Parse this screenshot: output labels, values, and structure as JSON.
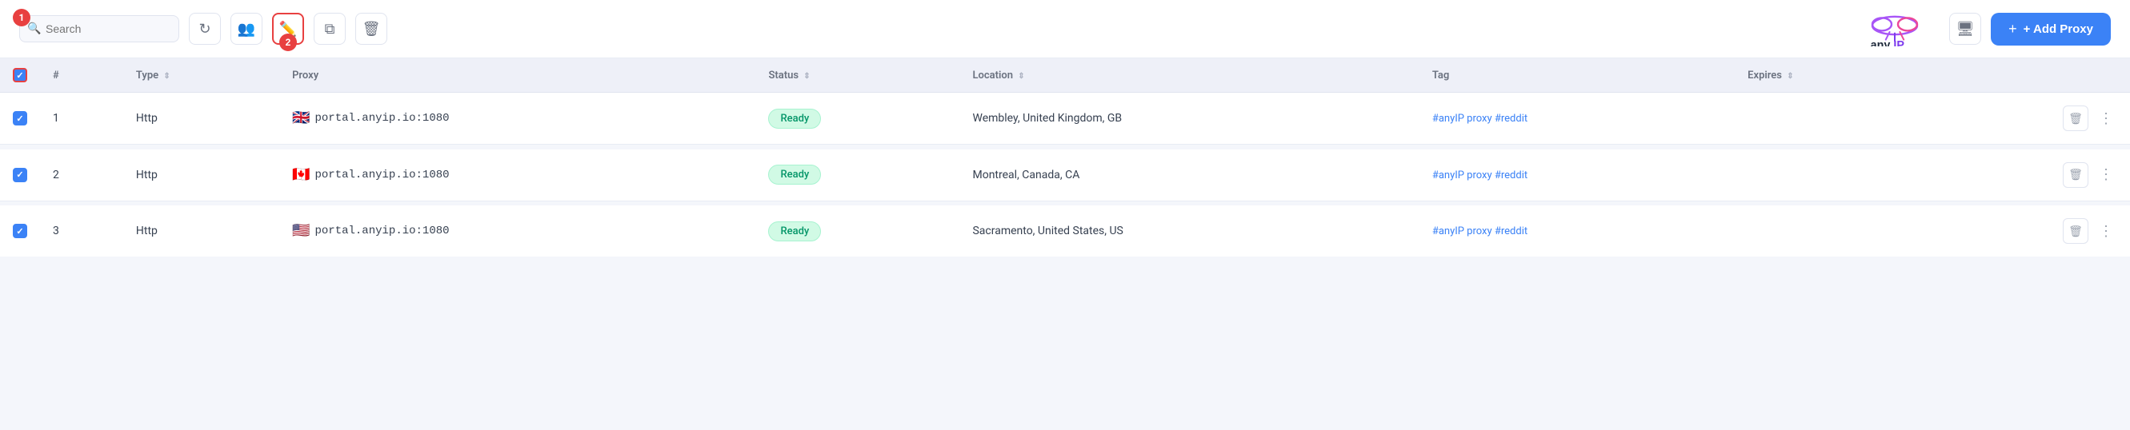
{
  "toolbar": {
    "search_placeholder": "Search",
    "refresh_label": "Refresh",
    "accounts_label": "Accounts",
    "edit_label": "Edit",
    "copy_label": "Copy",
    "delete_label": "Delete",
    "add_proxy_label": "+ Add Proxy",
    "monitor_label": "Monitor",
    "badge1": "1",
    "badge2": "2"
  },
  "table": {
    "columns": [
      {
        "key": "checkbox",
        "label": ""
      },
      {
        "key": "number",
        "label": "#"
      },
      {
        "key": "type",
        "label": "Type"
      },
      {
        "key": "proxy",
        "label": "Proxy"
      },
      {
        "key": "status",
        "label": "Status"
      },
      {
        "key": "location",
        "label": "Location"
      },
      {
        "key": "tag",
        "label": "Tag"
      },
      {
        "key": "expires",
        "label": "Expires"
      },
      {
        "key": "actions",
        "label": ""
      }
    ],
    "rows": [
      {
        "number": "1",
        "type": "Http",
        "flag": "🇬🇧",
        "proxy": "portal.anyip.io:1080",
        "status": "Ready",
        "location": "Wembley, United Kingdom, GB",
        "tags": "#anyIP proxy #reddit"
      },
      {
        "number": "2",
        "type": "Http",
        "flag": "🇨🇦",
        "proxy": "portal.anyip.io:1080",
        "status": "Ready",
        "location": "Montreal, Canada, CA",
        "tags": "#anyIP proxy #reddit"
      },
      {
        "number": "3",
        "type": "Http",
        "flag": "🇺🇸",
        "proxy": "portal.anyip.io:1080",
        "status": "Ready",
        "location": "Sacramento, United States, US",
        "tags": "#anyIP proxy #reddit"
      }
    ]
  },
  "brand": {
    "name": "anyIP",
    "tagline": "anyIP"
  },
  "colors": {
    "accent": "#3b82f6",
    "danger": "#e84040",
    "ready_bg": "#d1fae5",
    "ready_text": "#059669"
  }
}
